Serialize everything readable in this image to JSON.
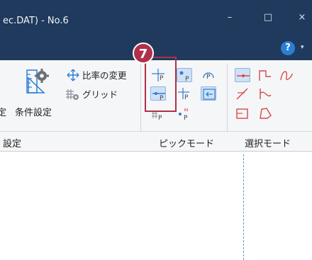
{
  "window": {
    "title": "ec.DAT) - No.6",
    "minimize_glyph": "–",
    "maximize_glyph": "□",
    "close_glyph": "×",
    "help_glyph": "?",
    "ribbon_options_glyph": "▾"
  },
  "ribbon": {
    "settings_group": {
      "label": "設定",
      "condition_button": "条件設定",
      "condition_prefix": "定",
      "ratio_button": "比率の変更",
      "grid_button": "グリッド"
    },
    "pick_mode_group": {
      "label": "ピックモード"
    },
    "select_mode_group": {
      "label": "選択モード"
    }
  },
  "callout": {
    "number": "7"
  },
  "colors": {
    "titlebar": "#1f3a5c",
    "accent": "#2b7fd4",
    "callout": "#b0304a",
    "select_icons": "#d84848",
    "dash": "#4a9ec2"
  },
  "icons": {
    "condition": "settings-ruler-gear-icon",
    "ratio": "move-arrows-icon",
    "grid": "grid-gear-icon"
  }
}
